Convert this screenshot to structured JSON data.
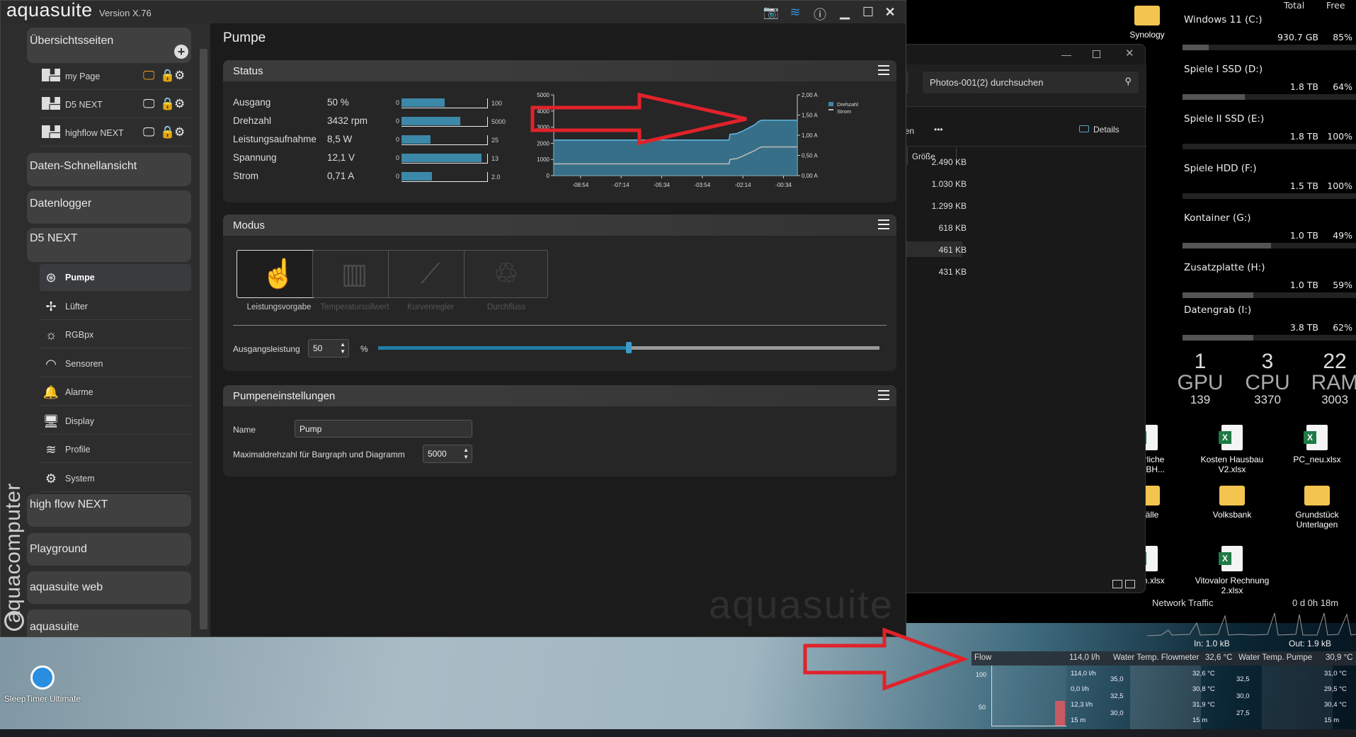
{
  "app": {
    "title": "aquasuite",
    "version": "Version X.76",
    "page_title": "Pumpe",
    "watermark": "aquasuite",
    "side_logo": "aquacomputer"
  },
  "sidebar": {
    "overview": {
      "label": "Übersichtsseiten",
      "pages": [
        {
          "label": "my Page",
          "active_display": true
        },
        {
          "label": "D5 NEXT",
          "active_display": false
        },
        {
          "label": "highflow NEXT",
          "active_display": false
        }
      ]
    },
    "sections": {
      "quick": "Daten-Schnellansicht",
      "logger": "Datenlogger",
      "device": "D5 NEXT",
      "highflow": "high flow NEXT",
      "playground": "Playground",
      "web": "aquasuite web",
      "aquasuite": "aquasuite"
    },
    "device_items": [
      {
        "label": "Pumpe",
        "icon": "pump-icon"
      },
      {
        "label": "Lüfter",
        "icon": "fan-icon"
      },
      {
        "label": "RGBpx",
        "icon": "bulb-icon"
      },
      {
        "label": "Sensoren",
        "icon": "gauge-icon"
      },
      {
        "label": "Alarme",
        "icon": "alarm-icon"
      },
      {
        "label": "Display",
        "icon": "display-icon"
      },
      {
        "label": "Profile",
        "icon": "layers-icon"
      },
      {
        "label": "System",
        "icon": "gear-icon"
      }
    ]
  },
  "status": {
    "title": "Status",
    "rows": [
      {
        "label": "Ausgang",
        "value": "50 %",
        "min": "0",
        "max": "100",
        "fill": 0.5
      },
      {
        "label": "Drehzahl",
        "value": "3432 rpm",
        "min": "0",
        "max": "5000",
        "fill": 0.686
      },
      {
        "label": "Leistungsaufnahme",
        "value": "8,5 W",
        "min": "0",
        "max": "25",
        "fill": 0.34
      },
      {
        "label": "Spannung",
        "value": "12,1 V",
        "min": "0",
        "max": "13",
        "fill": 0.93
      },
      {
        "label": "Strom",
        "value": "0,71 A",
        "min": "0",
        "max": "2.0",
        "fill": 0.355
      }
    ]
  },
  "chart_data": {
    "type": "area",
    "title": "",
    "x_unit": "seconds",
    "xlim": [
      -600,
      0
    ],
    "x_ticks": [
      -534,
      -434,
      -334,
      -234,
      -134,
      -34
    ],
    "x_tick_labels": [
      "-08:54",
      "-07:14",
      "-05:34",
      "-03:54",
      "-02:14",
      "-00:34"
    ],
    "ylim_left": [
      0,
      5000
    ],
    "y_ticks_left": [
      "0",
      "1000",
      "2000",
      "3000",
      "4000",
      "5000"
    ],
    "ylim_right": [
      0,
      2
    ],
    "y_ticks_right": [
      "0,00 A",
      "0,50 A",
      "1,00 A",
      "1,50 A",
      "2,00 A"
    ],
    "legend_position": "top-right",
    "series": [
      {
        "name": "Drehzahl",
        "axis": "left",
        "color": "#3c88a8",
        "x": [
          -600,
          -168,
          -166,
          -150,
          -135,
          -120,
          -105,
          -95,
          -88,
          0
        ],
        "y": [
          2200,
          2200,
          2550,
          2600,
          2750,
          2950,
          3150,
          3350,
          3432,
          3432
        ]
      },
      {
        "name": "Strom",
        "axis": "right",
        "color": "#b8b8b8",
        "x": [
          -600,
          -168,
          -166,
          -150,
          -135,
          -120,
          -105,
          -95,
          -88,
          0
        ],
        "y": [
          0.29,
          0.29,
          0.4,
          0.42,
          0.48,
          0.55,
          0.62,
          0.68,
          0.71,
          0.71
        ]
      }
    ]
  },
  "modus": {
    "title": "Modus",
    "modes": [
      {
        "label": "Leistungsvorgabe",
        "active": true
      },
      {
        "label": "Temperatursollwert",
        "active": false
      },
      {
        "label": "Kurvenregler",
        "active": false
      },
      {
        "label": "Durchfluss",
        "active": false
      }
    ],
    "output_label": "Ausgangsleistung",
    "output_value": "50",
    "unit": "%",
    "slider_percent": 50
  },
  "settings": {
    "title": "Pumpeneinstellungen",
    "name_label": "Name",
    "name_value": "Pump",
    "maxrpm_label": "Maximaldrehzahl für Bargraph und Diagramm",
    "maxrpm_value": "5000"
  },
  "explorer": {
    "search_placeholder": "Photos-001(2) durchsuchen",
    "toolbar_cut": "nen",
    "more": "•••",
    "details": "Details",
    "column": "Größe",
    "sizes": [
      "2.490 KB",
      "1.030 KB",
      "1.299 KB",
      "618 KB",
      "461 KB",
      "431 KB"
    ]
  },
  "drives": {
    "total_hdr": "Total",
    "free_hdr": "Free",
    "items": [
      {
        "name": "Windows 11 (C:)",
        "total": "930.7 GB",
        "free": "85%",
        "used": 0.15
      },
      {
        "name": "Spiele I SSD (D:)",
        "total": "1.8 TB",
        "free": "64%",
        "used": 0.36
      },
      {
        "name": "Spiele II SSD (E:)",
        "total": "1.8 TB",
        "free": "100%",
        "used": 0
      },
      {
        "name": "Spiele HDD (F:)",
        "total": "1.5 TB",
        "free": "100%",
        "used": 0
      },
      {
        "name": "Kontainer (G:)",
        "total": "1.0 TB",
        "free": "49%",
        "used": 0.51
      },
      {
        "name": "Zusatzplatte (H:)",
        "total": "1.0 TB",
        "free": "59%",
        "used": 0.41
      },
      {
        "name": "Datengrab (I:)",
        "total": "3.8 TB",
        "free": "62%",
        "used": 0.41
      }
    ]
  },
  "system": [
    {
      "value": "1",
      "label": "GPU",
      "sub": "139"
    },
    {
      "value": "3",
      "label": "CPU",
      "sub": "3370"
    },
    {
      "value": "22",
      "label": "RAM",
      "sub": "3003"
    }
  ],
  "desktop_icons": [
    {
      "label": "Synology",
      "type": "folder"
    },
    {
      "label": "euerliche\nung BH...",
      "type": "xlsx"
    },
    {
      "label": "Kosten Hausbau\nV2.xlsx",
      "type": "xlsx"
    },
    {
      "label": "PC_neu.xlsx",
      "type": "xlsx"
    },
    {
      "label": "erfälle",
      "type": "folder"
    },
    {
      "label": "Volksbank",
      "type": "folder"
    },
    {
      "label": "Grundstück\nUnterlagen",
      "type": "folder"
    },
    {
      "label": "ssen.xlsx",
      "type": "xlsx"
    },
    {
      "label": "Vitovalor Rechnung\n2.xlsx",
      "type": "xlsx"
    },
    {
      "label": "SleepTimer Ultimate",
      "type": "app"
    }
  ],
  "network": {
    "title": "Network Traffic",
    "uptime": "0 d 0h 18m",
    "in": "In: 1.0 kB",
    "out": "Out: 1.9 kB"
  },
  "flow_widget": {
    "flow": {
      "label": "Flow",
      "value": "114,0 l/h",
      "ticks": [
        "100",
        "50"
      ],
      "stats": [
        "114,0 l/h",
        "0,0 l/h",
        "12,3 l/h",
        "15 m"
      ]
    },
    "temp_flow": {
      "label": "Water Temp. Flowmeter",
      "value": "32,6 °C",
      "ticks": [
        "35,0",
        "32,5",
        "30,0"
      ],
      "stats": [
        "32,6 °C",
        "30,8 °C",
        "31,9 °C",
        "15 m"
      ]
    },
    "temp_pump": {
      "label": "Water Temp. Pumpe",
      "value": "30,9 °C",
      "ticks": [
        "32,5",
        "30,0",
        "27,5"
      ],
      "stats": [
        "31,0 °C",
        "29,5 °C",
        "30,4 °C",
        "15 m"
      ]
    }
  }
}
